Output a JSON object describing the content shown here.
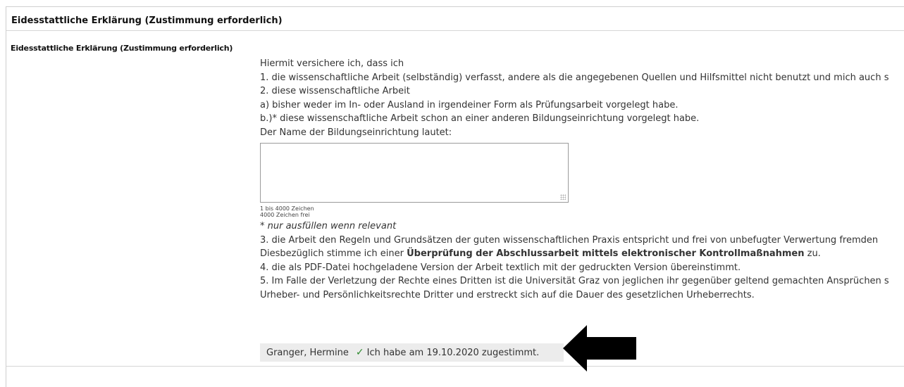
{
  "section": {
    "title": "Eidesstattliche Erklärung (Zustimmung erforderlich)"
  },
  "field": {
    "label": "Eidesstattliche Erklärung (Zustimmung erforderlich)"
  },
  "declaration": {
    "lines": [
      "Hiermit versichere ich, dass ich",
      "1. die wissenschaftliche Arbeit (selbständig) verfasst, andere als die angegebenen Quellen und Hilfsmittel nicht benutzt und mich auch s",
      "2. diese wissenschaftliche Arbeit",
      "a) bisher weder im In- oder Ausland in irgendeiner Form als Prüfungsarbeit vorgelegt habe.",
      "b.)* diese wissenschaftliche Arbeit schon an einer anderen Bildungseinrichtung vorgelegt habe.",
      "Der Name der Bildungseinrichtung lautet:"
    ],
    "textarea_value": "",
    "counter_range": "1 bis 4000 Zeichen",
    "counter_free": "4000 Zeichen frei",
    "note": "* nur ausfüllen wenn relevant",
    "point3": "3. die Arbeit den Regeln und Grundsätzen der guten wissenschaftlichen Praxis entspricht und frei von unbefugter Verwertung fremden",
    "consent_line_prefix": "Diesbezüglich stimme ich einer ",
    "consent_line_bold": "Überprüfung der Abschlussarbeit mittels elektronischer Kontrollmaßnahmen",
    "consent_line_suffix": " zu.",
    "point4": "4. die als PDF-Datei hochgeladene Version der Arbeit textlich mit der gedruckten Version übereinstimmt.",
    "point5a": "5. Im Falle der Verletzung der Rechte eines Dritten ist die Universität Graz von jeglichen ihr gegenüber geltend gemachten Ansprüchen s",
    "point5b": "Urheber- und Persönlichkeitsrechte Dritter und erstreckt sich auf die Dauer des gesetzlichen Urheberrechts."
  },
  "consent": {
    "name": "Granger, Hermine",
    "check_icon": "✓",
    "status": "Ich habe am 19.10.2020 zugestimmt."
  },
  "colors": {
    "check": "#2d8a2d",
    "arrow": "#000000"
  }
}
